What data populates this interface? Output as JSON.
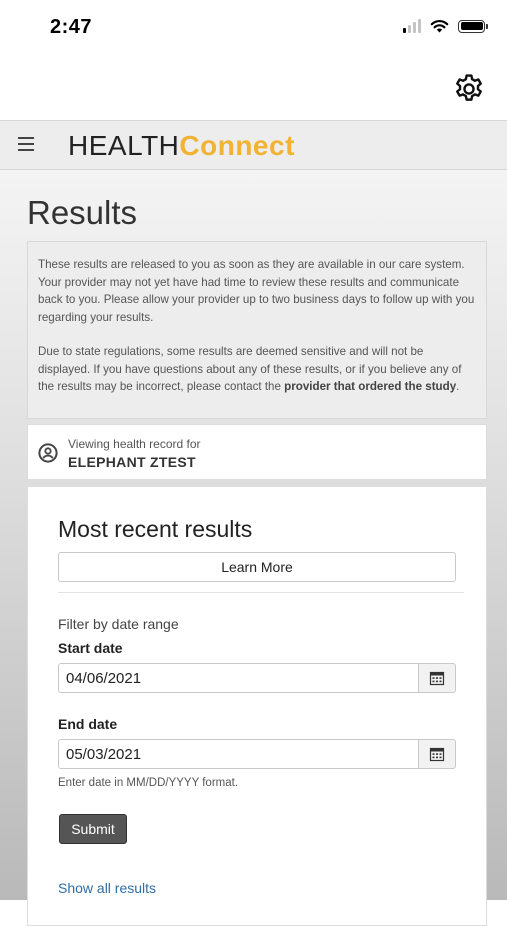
{
  "status_bar": {
    "time": "2:47"
  },
  "app": {
    "logo_part1": "HEALTH",
    "logo_part2": "Connect",
    "brand_color": "#f2b233"
  },
  "page": {
    "title": "Results",
    "notice": {
      "para1": "These results are released to you as soon as they are available in our care system.  Your provider may not yet have had time to review these results and communicate back to you.  Please allow your provider up to two business days to follow up with you regarding your results.",
      "para2_text": "Due to state regulations, some results are deemed sensitive and will not be displayed. If you have questions about any of these results, or if you believe any of the results may be incorrect, please contact the ",
      "para2_bold": "provider that ordered the study",
      "para2_end": "."
    },
    "record": {
      "label": "Viewing health record for",
      "name": "ELEPHANT ZTEST"
    },
    "results": {
      "title": "Most recent results",
      "learn_more": "Learn More",
      "filter_label": "Filter by date range",
      "start_label": "Start date",
      "start_value": "04/06/2021",
      "end_label": "End date",
      "end_value": "05/03/2021",
      "hint": "Enter date in MM/DD/YYYY format.",
      "submit": "Submit",
      "show_all": "Show all results"
    }
  },
  "icons": {
    "settings": "gear-icon",
    "menu": "hamburger-menu-icon",
    "person": "person-circle-icon",
    "calendar": "calendar-icon"
  }
}
